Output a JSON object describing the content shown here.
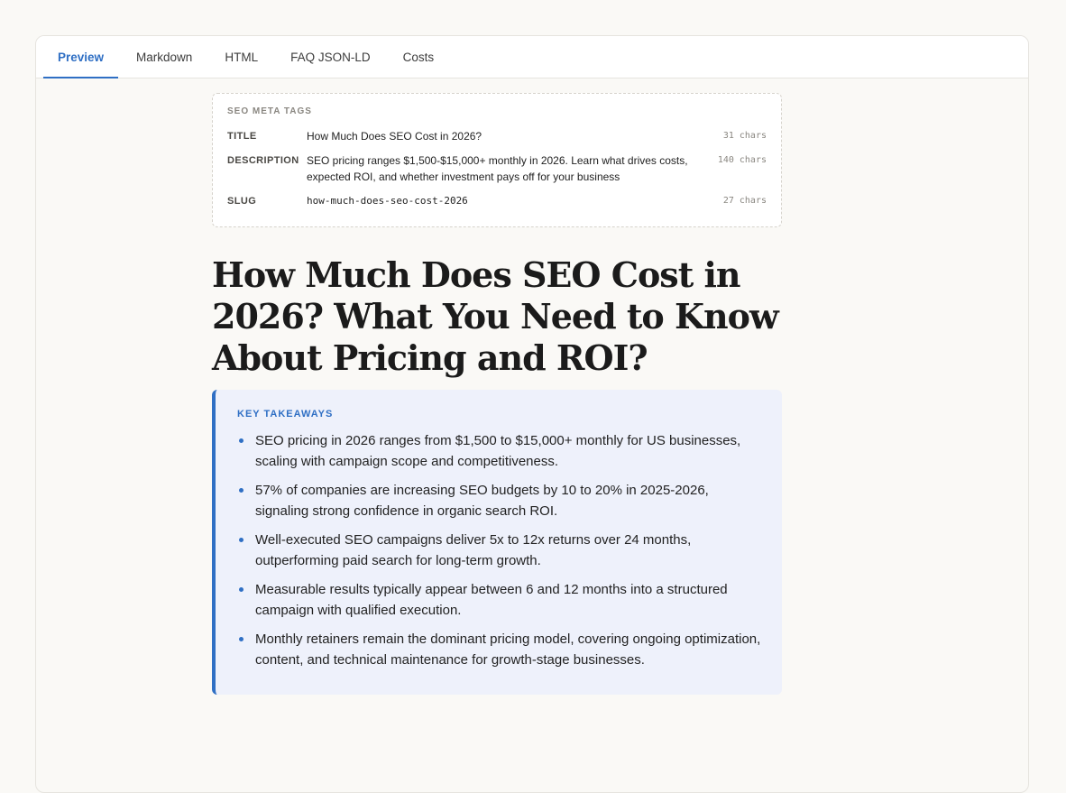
{
  "tabs": [
    {
      "label": "Preview",
      "active": true
    },
    {
      "label": "Markdown",
      "active": false
    },
    {
      "label": "HTML",
      "active": false
    },
    {
      "label": "FAQ JSON-LD",
      "active": false
    },
    {
      "label": "Costs",
      "active": false
    }
  ],
  "seo_meta": {
    "heading": "SEO META TAGS",
    "rows": [
      {
        "label": "TITLE",
        "value": "How Much Does SEO Cost in 2026?",
        "count": "31 chars"
      },
      {
        "label": "DESCRIPTION",
        "value": "SEO pricing ranges $1,500-$15,000+ monthly in 2026. Learn what drives costs, expected ROI, and whether investment pays off for your business",
        "count": "140 chars"
      },
      {
        "label": "SLUG",
        "value": "how-much-does-seo-cost-2026",
        "count": "27 chars"
      }
    ]
  },
  "article": {
    "title": "How Much Does SEO Cost in 2026? What You Need to Know About Pricing and ROI?"
  },
  "key_takeaways": {
    "heading": "KEY TAKEAWAYS",
    "items": [
      "SEO pricing in 2026 ranges from $1,500 to $15,000+ monthly for US businesses, scaling with campaign scope and competitiveness.",
      "57% of companies are increasing SEO budgets by 10 to 20% in 2025-2026, signaling strong confidence in organic search ROI.",
      "Well-executed SEO campaigns deliver 5x to 12x returns over 24 months, outperforming paid search for long-term growth.",
      "Measurable results typically appear between 6 and 12 months into a structured campaign with qualified execution.",
      "Monthly retainers remain the dominant pricing model, covering ongoing optimization, content, and technical maintenance for growth-stage businesses."
    ]
  },
  "colors": {
    "accent": "#2f6fc4",
    "background": "#faf9f6",
    "takeaways_bg": "#eef1fb"
  }
}
